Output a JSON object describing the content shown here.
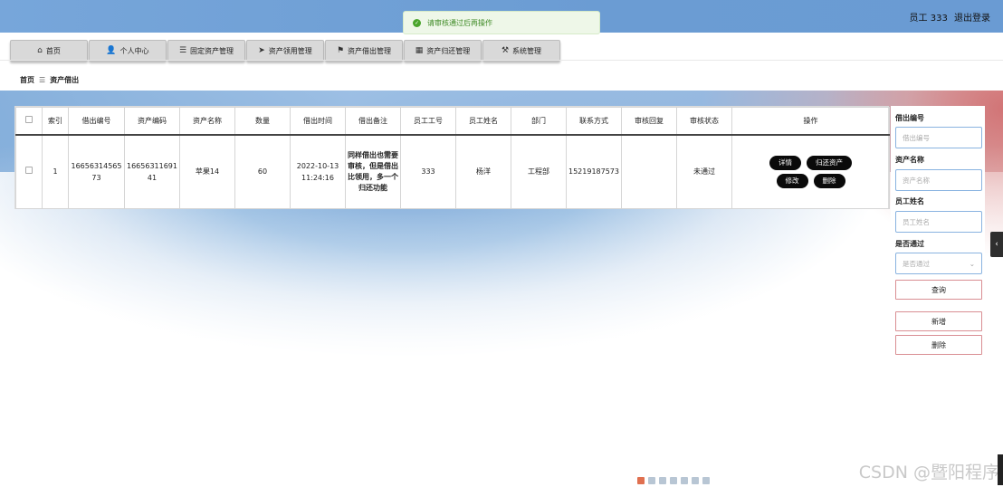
{
  "user": {
    "greeting": "员工 333",
    "logout": "退出登录"
  },
  "toast": {
    "message": "请审核通过后再操作"
  },
  "nav": [
    {
      "icon": "home-icon",
      "glyph": "⌂",
      "label": "首页",
      "w": 86
    },
    {
      "icon": "user-icon",
      "glyph": "👤",
      "label": "个人中心",
      "w": 86
    },
    {
      "icon": "list-icon",
      "glyph": "☰",
      "label": "固定资产管理",
      "w": 86
    },
    {
      "icon": "send-icon",
      "glyph": "➤",
      "label": "资产领用管理",
      "w": 86
    },
    {
      "icon": "flag-icon",
      "glyph": "⚑",
      "label": "资产借出管理",
      "w": 86
    },
    {
      "icon": "grid-icon",
      "glyph": "▦",
      "label": "资产归还管理",
      "w": 86
    },
    {
      "icon": "tool-icon",
      "glyph": "⚒",
      "label": "系统管理",
      "w": 86
    }
  ],
  "breadcrumb": {
    "home": "首页",
    "sep": "☰",
    "current": "资产借出"
  },
  "table": {
    "headers": [
      "索引",
      "借出编号",
      "资产编码",
      "资产名称",
      "数量",
      "借出时间",
      "借出备注",
      "员工工号",
      "员工姓名",
      "部门",
      "联系方式",
      "审核回复",
      "审核状态",
      "操作"
    ],
    "row": {
      "index": "1",
      "loan_no": "1665631456573",
      "asset_code": "1665631169141",
      "asset_name": "苹果14",
      "qty": "60",
      "loan_time": "2022-10-13 11:24:16",
      "remark": "同样借出也需要审核，但是借出比领用，多一个归还功能",
      "emp_no": "333",
      "emp_name": "杨洋",
      "dept": "工程部",
      "phone": "15219187573",
      "reply": "",
      "status": "未通过"
    },
    "ops": {
      "detail": "详情",
      "return": "归还资产",
      "edit": "修改",
      "delete": "删除"
    }
  },
  "search": {
    "loan_no_label": "借出编号",
    "loan_no_placeholder": "借出编号",
    "asset_name_label": "资产名称",
    "asset_name_placeholder": "资产名称",
    "emp_name_label": "员工姓名",
    "emp_name_placeholder": "员工姓名",
    "passed_label": "是否通过",
    "passed_placeholder": "是否通过",
    "query": "查询",
    "add": "新增",
    "delete": "删除"
  },
  "watermark": "CSDN @暨阳程序"
}
